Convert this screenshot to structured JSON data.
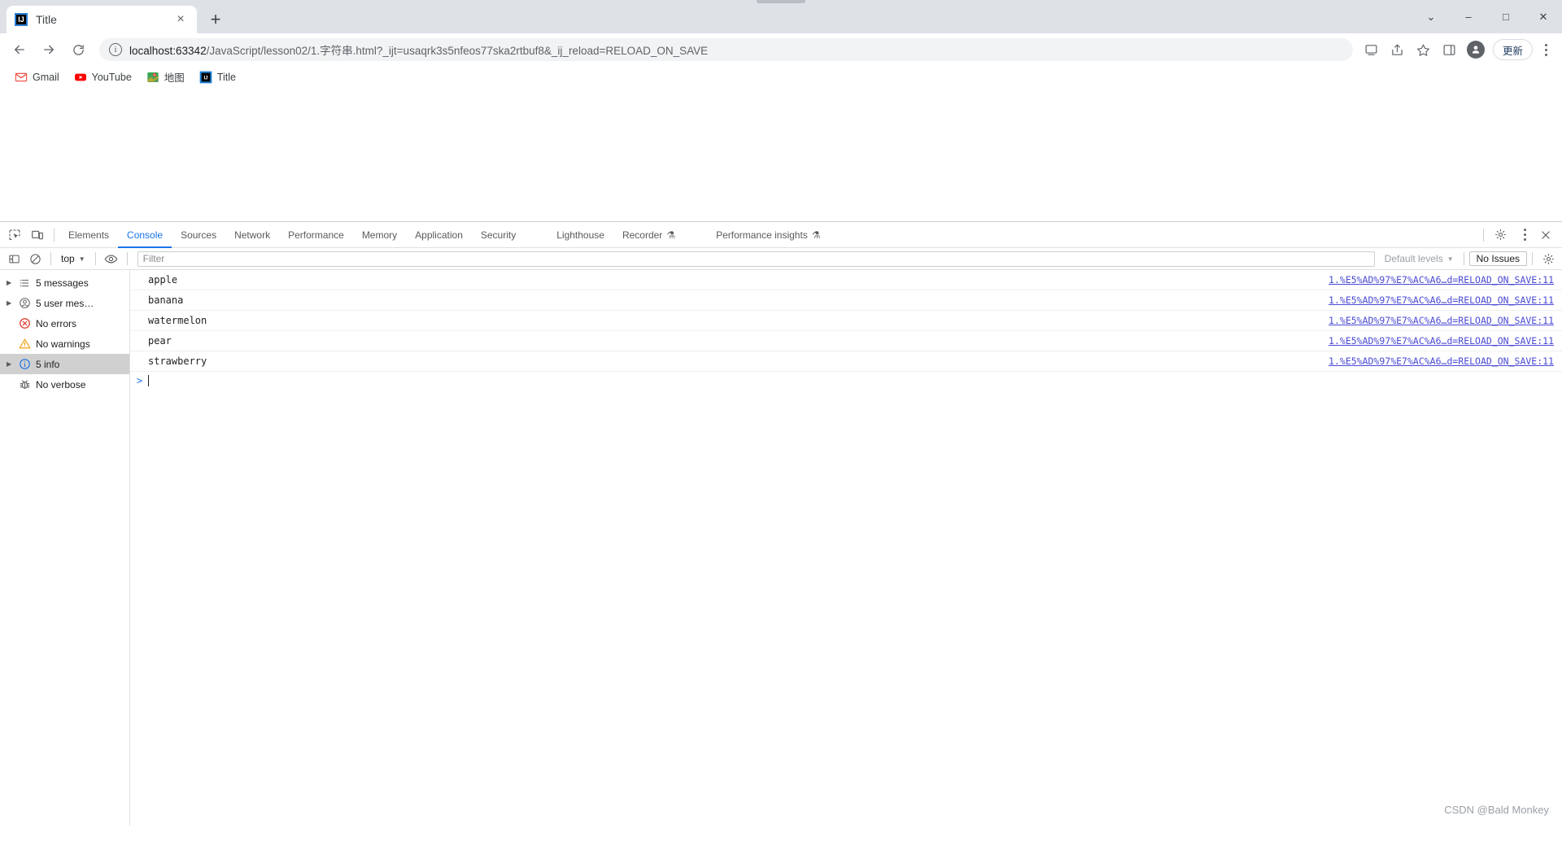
{
  "browser": {
    "tab": {
      "title": "Title",
      "favicon_name": "intellij-idea-icon",
      "favicon_text": "IJ",
      "close_label": "×"
    },
    "new_tab_label": "+",
    "window_controls": {
      "minimize": "–",
      "maximize": "□",
      "close": "✕",
      "chevron": "⌄"
    },
    "nav": {
      "back": "←",
      "forward": "→",
      "reload": "⟳"
    },
    "omnibox": {
      "info_icon": "i",
      "host": "localhost:63342",
      "path": "/JavaScript/lesson02/1.字符串.html?_ijt=usaqrk3s5nfeos77ska2rtbuf8&_ij_reload=RELOAD_ON_SAVE",
      "full_url": "localhost:63342/JavaScript/lesson02/1.字符串.html?_ijt=usaqrk3s5nfeos77ska2rtbuf8&_ij_reload=RELOAD_ON_SAVE"
    },
    "toolbar_right": {
      "cast_icon": "cast-icon",
      "share_icon": "share-icon",
      "bookmark_star": "☆",
      "sidepanel_icon": "side-panel-icon",
      "profile_icon": "profile-avatar",
      "update_label": "更新",
      "menu_icon": "three-dot-menu"
    },
    "bookmarks": [
      {
        "label": "Gmail",
        "icon": "gmail-icon"
      },
      {
        "label": "YouTube",
        "icon": "youtube-icon"
      },
      {
        "label": "地图",
        "icon": "google-maps-icon"
      },
      {
        "label": "Title",
        "icon": "intellij-idea-icon"
      }
    ]
  },
  "devtools": {
    "left_icons": [
      {
        "name": "inspect-element-icon"
      },
      {
        "name": "device-toolbar-icon"
      }
    ],
    "tabs": [
      {
        "label": "Elements",
        "active": false,
        "flask": ""
      },
      {
        "label": "Console",
        "active": true,
        "flask": ""
      },
      {
        "label": "Sources",
        "active": false,
        "flask": ""
      },
      {
        "label": "Network",
        "active": false,
        "flask": ""
      },
      {
        "label": "Performance",
        "active": false,
        "flask": ""
      },
      {
        "label": "Memory",
        "active": false,
        "flask": ""
      },
      {
        "label": "Application",
        "active": false,
        "flask": ""
      },
      {
        "label": "Security",
        "active": false,
        "flask": ""
      },
      {
        "label": "Lighthouse",
        "active": false,
        "flask": ""
      },
      {
        "label": "Recorder",
        "active": false,
        "flask": "⚗"
      },
      {
        "label": "Performance insights",
        "active": false,
        "flask": "⚗"
      }
    ],
    "tabbar_right": {
      "settings_icon": "gear-icon",
      "more_icon": "three-dot-menu",
      "close_icon": "close-icon"
    },
    "filterbar": {
      "sidebar_toggle_icon": "console-sidebar-toggle-icon",
      "clear_icon": "clear-console-icon",
      "context": "top",
      "context_caret": "▼",
      "eye_icon": "live-expression-icon",
      "filter_placeholder": "Filter",
      "filter_value": "",
      "levels_label": "Default levels",
      "levels_caret": "▼",
      "issues_label": "No Issues",
      "settings_icon": "gear-icon"
    },
    "sidebar": [
      {
        "label": "5 messages",
        "icon": "list-icon",
        "arrow": "▶",
        "selected": false
      },
      {
        "label": "5 user mes…",
        "icon": "user-icon",
        "arrow": "▶",
        "selected": false
      },
      {
        "label": "No errors",
        "icon": "error-icon",
        "arrow": "",
        "selected": false
      },
      {
        "label": "No warnings",
        "icon": "warning-icon",
        "arrow": "",
        "selected": false
      },
      {
        "label": "5 info",
        "icon": "info-icon",
        "arrow": "▶",
        "selected": true
      },
      {
        "label": "No verbose",
        "icon": "bug-icon",
        "arrow": "",
        "selected": false
      }
    ],
    "console_logs": [
      {
        "text": "apple",
        "source": "1.%E5%AD%97%E7%AC%A6…d=RELOAD_ON_SAVE:11"
      },
      {
        "text": "banana",
        "source": "1.%E5%AD%97%E7%AC%A6…d=RELOAD_ON_SAVE:11"
      },
      {
        "text": "watermelon",
        "source": "1.%E5%AD%97%E7%AC%A6…d=RELOAD_ON_SAVE:11"
      },
      {
        "text": "pear",
        "source": "1.%E5%AD%97%E7%AC%A6…d=RELOAD_ON_SAVE:11"
      },
      {
        "text": "strawberry",
        "source": "1.%E5%AD%97%E7%AC%A6…d=RELOAD_ON_SAVE:11"
      }
    ],
    "prompt": {
      "caret": ">",
      "value": ""
    }
  },
  "watermark": "CSDN @Bald Monkey",
  "colors": {
    "accent": "#1a73e8",
    "link": "#4a4ad4",
    "chrome_bg": "#dee1e6",
    "error": "#d93025",
    "warning": "#f29900"
  }
}
